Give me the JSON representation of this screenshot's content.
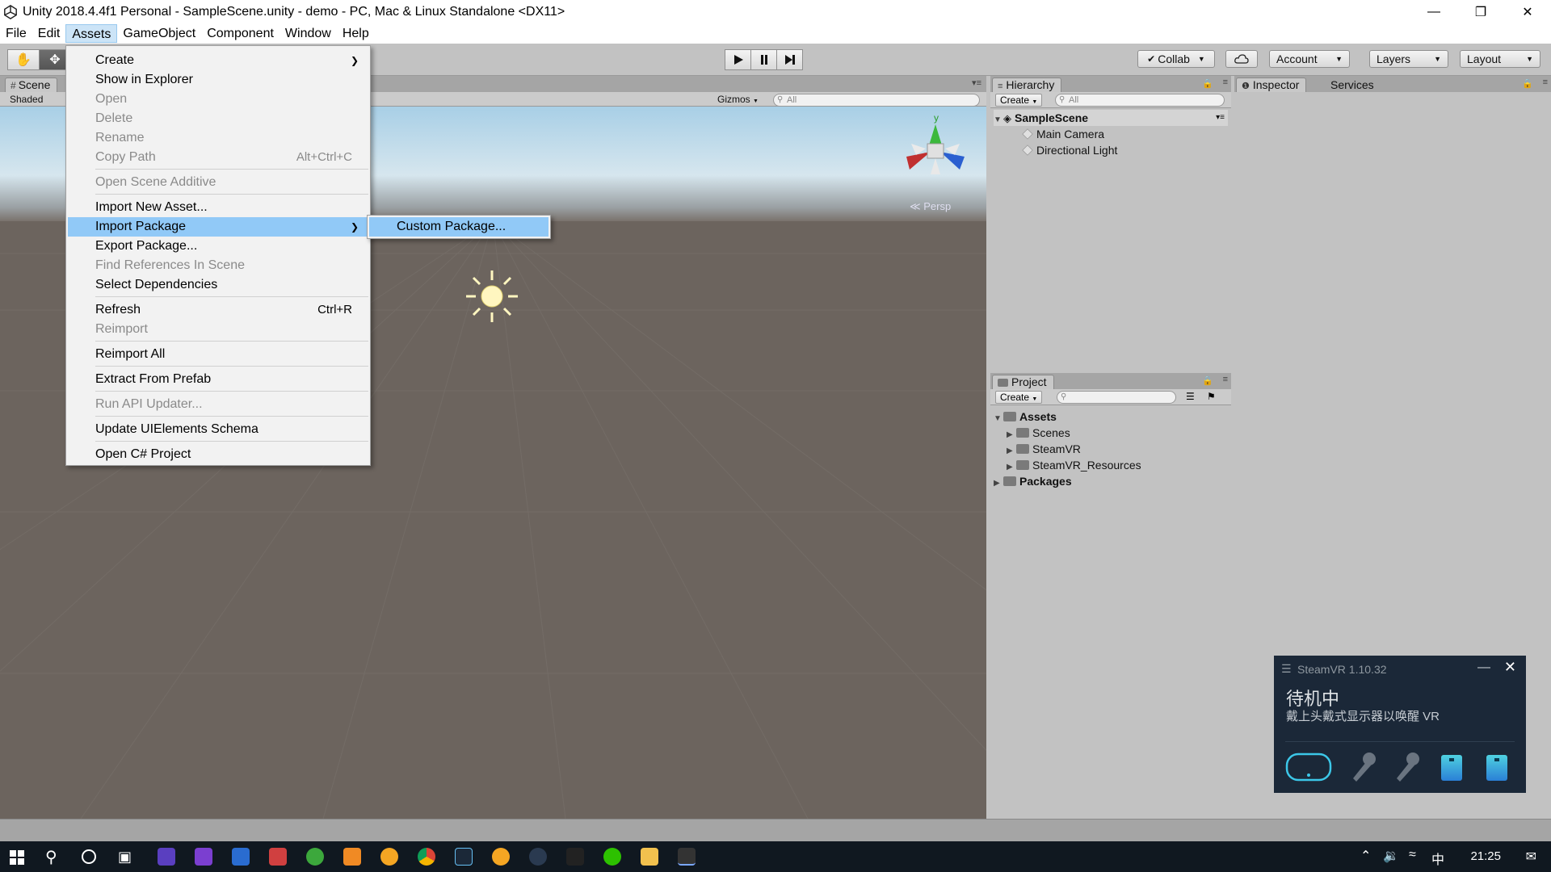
{
  "window": {
    "title": "Unity 2018.4.4f1 Personal - SampleScene.unity - demo - PC, Mac & Linux Standalone <DX11>"
  },
  "menubar": [
    "File",
    "Edit",
    "Assets",
    "GameObject",
    "Component",
    "Window",
    "Help"
  ],
  "toolbar": {
    "collab": "Collab",
    "account": "Account",
    "layers": "Layers",
    "layout": "Layout"
  },
  "scene": {
    "tab": "Scene",
    "shading": "Shaded",
    "gizmos": "Gizmos",
    "search_placeholder": "All",
    "persp": "Persp",
    "gizmo_y": "y"
  },
  "assets_menu": [
    {
      "label": "Create",
      "shortcut": "",
      "submenu": true,
      "disabled": false
    },
    {
      "label": "Show in Explorer",
      "shortcut": "",
      "submenu": false,
      "disabled": false
    },
    {
      "label": "Open",
      "shortcut": "",
      "submenu": false,
      "disabled": true
    },
    {
      "label": "Delete",
      "shortcut": "",
      "submenu": false,
      "disabled": true
    },
    {
      "label": "Rename",
      "shortcut": "",
      "submenu": false,
      "disabled": true
    },
    {
      "label": "Copy Path",
      "shortcut": "Alt+Ctrl+C",
      "submenu": false,
      "disabled": true
    },
    {
      "label": "Open Scene Additive",
      "shortcut": "",
      "submenu": false,
      "disabled": true
    },
    {
      "label": "Import New Asset...",
      "shortcut": "",
      "submenu": false,
      "disabled": false
    },
    {
      "label": "Import Package",
      "shortcut": "",
      "submenu": true,
      "disabled": false,
      "highlighted": true
    },
    {
      "label": "Export Package...",
      "shortcut": "",
      "submenu": false,
      "disabled": false
    },
    {
      "label": "Find References In Scene",
      "shortcut": "",
      "submenu": false,
      "disabled": true
    },
    {
      "label": "Select Dependencies",
      "shortcut": "",
      "submenu": false,
      "disabled": false
    },
    {
      "label": "Refresh",
      "shortcut": "Ctrl+R",
      "submenu": false,
      "disabled": false
    },
    {
      "label": "Reimport",
      "shortcut": "",
      "submenu": false,
      "disabled": true
    },
    {
      "label": "Reimport All",
      "shortcut": "",
      "submenu": false,
      "disabled": false
    },
    {
      "label": "Extract From Prefab",
      "shortcut": "",
      "submenu": false,
      "disabled": false
    },
    {
      "label": "Run API Updater...",
      "shortcut": "",
      "submenu": false,
      "disabled": true
    },
    {
      "label": "Update UIElements Schema",
      "shortcut": "",
      "submenu": false,
      "disabled": false
    },
    {
      "label": "Open C# Project",
      "shortcut": "",
      "submenu": false,
      "disabled": false
    }
  ],
  "import_submenu": {
    "label": "Custom Package..."
  },
  "hierarchy": {
    "tab": "Hierarchy",
    "create": "Create",
    "search_placeholder": "All",
    "scene": "SampleScene",
    "items": [
      "Main Camera",
      "Directional Light"
    ]
  },
  "project": {
    "tab": "Project",
    "create": "Create",
    "root": "Assets",
    "folders": [
      "Scenes",
      "SteamVR",
      "SteamVR_Resources"
    ],
    "packages": "Packages"
  },
  "inspector": {
    "tab": "Inspector",
    "services": "Services"
  },
  "steamvr": {
    "header": "SteamVR 1.10.32",
    "status": "待机中",
    "subtitle": "戴上头戴式显示器以唤醒 VR"
  },
  "taskbar": {
    "ime": "中",
    "time": "21:25"
  }
}
